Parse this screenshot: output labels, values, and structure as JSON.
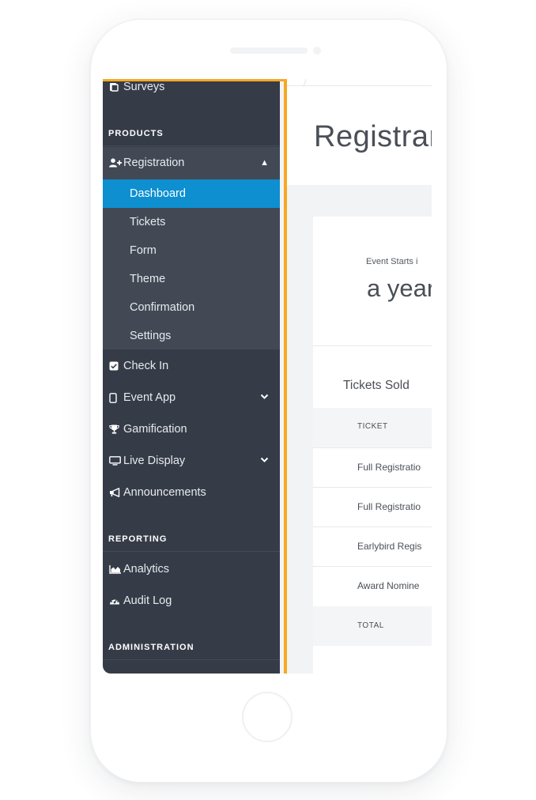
{
  "sidebar": {
    "top_item": {
      "label": "Surveys",
      "icon": "survey-icon"
    },
    "products_title": "PRODUCTS",
    "registration": {
      "label": "Registration",
      "icon": "user-plus-icon",
      "chevron": "▲"
    },
    "sub_items": [
      {
        "label": "Dashboard",
        "active": true
      },
      {
        "label": "Tickets",
        "active": false
      },
      {
        "label": "Form",
        "active": false
      },
      {
        "label": "Theme",
        "active": false
      },
      {
        "label": "Confirmation",
        "active": false
      },
      {
        "label": "Settings",
        "active": false
      }
    ],
    "items": [
      {
        "label": "Check In",
        "icon": "check-square-icon",
        "chevron": ""
      },
      {
        "label": "Event App",
        "icon": "phone-icon",
        "chevron": "⌄"
      },
      {
        "label": "Gamification",
        "icon": "trophy-icon",
        "chevron": ""
      },
      {
        "label": "Live Display",
        "icon": "monitor-icon",
        "chevron": "⌄"
      },
      {
        "label": "Announcements",
        "icon": "megaphone-icon",
        "chevron": ""
      }
    ],
    "reporting_title": "REPORTING",
    "reporting_items": [
      {
        "label": "Analytics",
        "icon": "area-chart-icon"
      },
      {
        "label": "Audit Log",
        "icon": "dashboard-icon"
      }
    ],
    "administration_title": "ADMINISTRATION",
    "colors": {
      "background": "#363c47",
      "active": "#0d8fd0",
      "highlight_border": "#f7a823"
    }
  },
  "main": {
    "page_title": "Registrar",
    "countdown_label": "Event Starts i",
    "countdown_value": "a year",
    "tickets_title": "Tickets Sold",
    "table_header": "TICKET",
    "rows": [
      "Full Registratio",
      "Full Registratio",
      "Earlybird Regis",
      "Award Nomine"
    ],
    "table_footer": "TOTAL"
  }
}
